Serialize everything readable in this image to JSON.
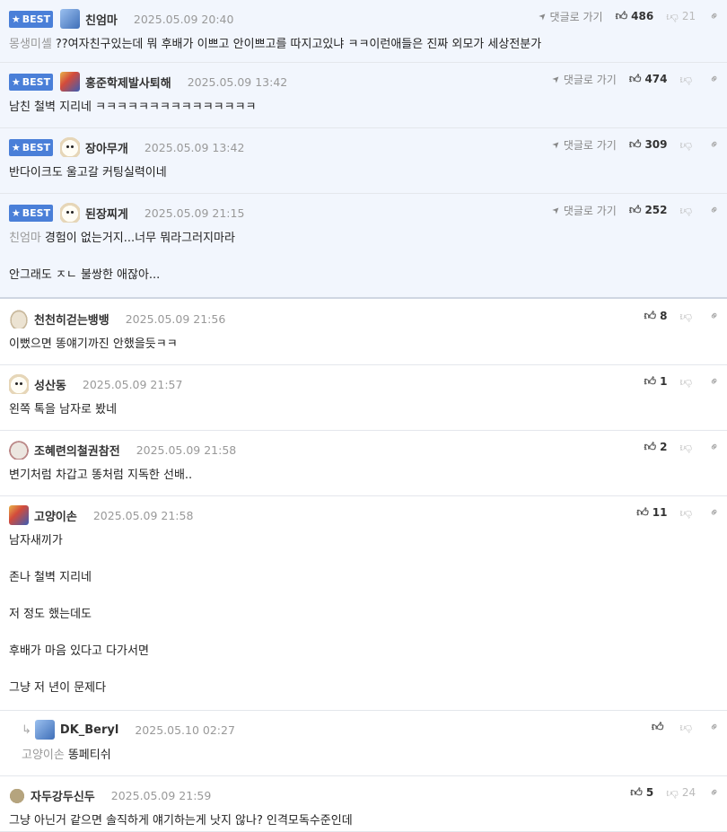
{
  "labels": {
    "best": "BEST",
    "reply_to": "댓글로 가기"
  },
  "colors": {
    "best_bg": "#f2f6fd",
    "badge": "#4a7fd8",
    "mention": "#999999"
  },
  "icons": [
    "star-icon",
    "reply-arrow-icon",
    "thumb-up-icon",
    "thumb-down-icon",
    "link-icon"
  ],
  "comments": [
    {
      "best": true,
      "avatar": "blue-avatar",
      "nick": "친엄마",
      "date": "2025.05.09 20:40",
      "up": "486",
      "down": "21",
      "mention": "몽생미셸",
      "lines": [
        "??여자친구있는데 뭐 후배가 이쁘고 안이쁘고를 따지고있냐 ㅋㅋ이런애들은 진짜 외모가 세상전분가"
      ]
    },
    {
      "best": true,
      "avatar": "multi-avatar",
      "nick": "홍준학제발사퇴해",
      "date": "2025.05.09 13:42",
      "up": "474",
      "down": "",
      "mention": "",
      "lines": [
        "남친 철벽 지리네 ㅋㅋㅋㅋㅋㅋㅋㅋㅋㅋㅋㅋㅋㅋㅋ"
      ]
    },
    {
      "best": true,
      "avatar": "dog-avatar",
      "nick": "장아무개",
      "date": "2025.05.09 13:42",
      "up": "309",
      "down": "",
      "mention": "",
      "lines": [
        "반다이크도 울고갈 커팅실력이네"
      ]
    },
    {
      "best": true,
      "avatar": "dog-avatar",
      "nick": "된장찌게",
      "date": "2025.05.09 21:15",
      "up": "252",
      "down": "",
      "mention": "친엄마",
      "lines": [
        "경험이 없는거지...너무 뭐라그러지마라",
        "안그래도 ㅈㄴ 불쌍한 애잖아..."
      ]
    },
    {
      "best": false,
      "avatar": "pig-avatar",
      "nick": "천천히걷는뱅뱅",
      "date": "2025.05.09 21:56",
      "up": "8",
      "down": "",
      "mention": "",
      "lines": [
        "이뻤으면 똥얘기까진 안했을듯ㅋㅋ"
      ]
    },
    {
      "best": false,
      "avatar": "dog-avatar",
      "nick": "성산동",
      "date": "2025.05.09 21:57",
      "up": "1",
      "down": "",
      "mention": "",
      "lines": [
        "왼쪽 톡을 남자로 봤네"
      ]
    },
    {
      "best": false,
      "avatar": "mouse-avatar",
      "nick": "조혜련의철권참전",
      "date": "2025.05.09 21:58",
      "up": "2",
      "down": "",
      "mention": "",
      "lines": [
        "변기처럼 차갑고 똥처럼 지독한 선배.."
      ]
    },
    {
      "best": false,
      "avatar": "multi-avatar",
      "nick": "고양이손",
      "date": "2025.05.09 21:58",
      "up": "11",
      "down": "",
      "mention": "",
      "lines": [
        "남자새끼가",
        "존나 철벽 지리네",
        "저 정도 했는데도",
        "후배가 마음 있다고 다가서면",
        "그냥 저 년이 문제다"
      ]
    },
    {
      "best": false,
      "reply": true,
      "avatar": "blue-avatar",
      "nick": "DK_Beryl",
      "date": "2025.05.10 02:27",
      "up": "",
      "down": "",
      "mention": "고양이손",
      "lines": [
        "똥페티쉬"
      ]
    },
    {
      "best": false,
      "avatar": "brown-avatar",
      "nick": "자두강두신두",
      "date": "2025.05.09 21:59",
      "up": "5",
      "down": "24",
      "mention": "",
      "lines": [
        "그냥 아닌거 같으면 솔직하게 얘기하는게 낫지 않나? 인격모독수준인데"
      ]
    }
  ]
}
